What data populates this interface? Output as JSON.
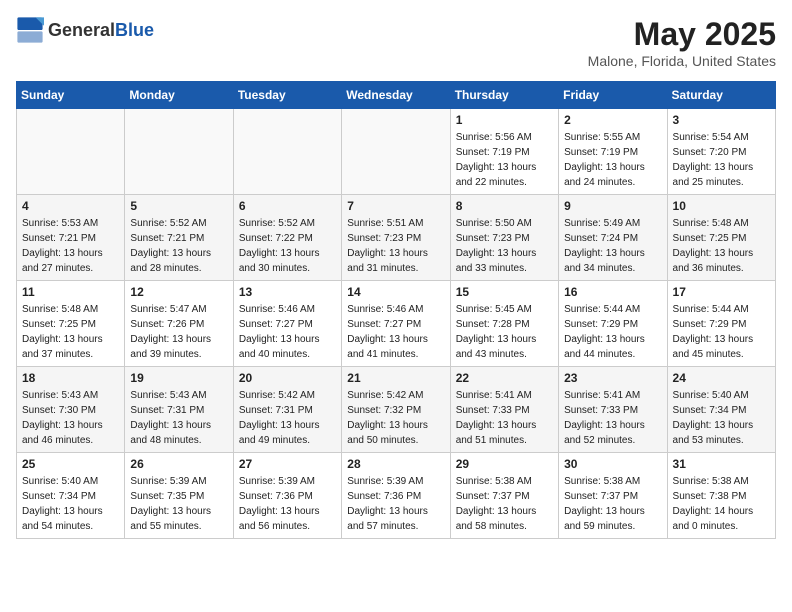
{
  "header": {
    "logo_general": "General",
    "logo_blue": "Blue",
    "title": "May 2025",
    "subtitle": "Malone, Florida, United States"
  },
  "calendar": {
    "days_of_week": [
      "Sunday",
      "Monday",
      "Tuesday",
      "Wednesday",
      "Thursday",
      "Friday",
      "Saturday"
    ],
    "weeks": [
      [
        {
          "day": null,
          "info": null
        },
        {
          "day": null,
          "info": null
        },
        {
          "day": null,
          "info": null
        },
        {
          "day": null,
          "info": null
        },
        {
          "day": "1",
          "info": "Sunrise: 5:56 AM\nSunset: 7:19 PM\nDaylight: 13 hours\nand 22 minutes."
        },
        {
          "day": "2",
          "info": "Sunrise: 5:55 AM\nSunset: 7:19 PM\nDaylight: 13 hours\nand 24 minutes."
        },
        {
          "day": "3",
          "info": "Sunrise: 5:54 AM\nSunset: 7:20 PM\nDaylight: 13 hours\nand 25 minutes."
        }
      ],
      [
        {
          "day": "4",
          "info": "Sunrise: 5:53 AM\nSunset: 7:21 PM\nDaylight: 13 hours\nand 27 minutes."
        },
        {
          "day": "5",
          "info": "Sunrise: 5:52 AM\nSunset: 7:21 PM\nDaylight: 13 hours\nand 28 minutes."
        },
        {
          "day": "6",
          "info": "Sunrise: 5:52 AM\nSunset: 7:22 PM\nDaylight: 13 hours\nand 30 minutes."
        },
        {
          "day": "7",
          "info": "Sunrise: 5:51 AM\nSunset: 7:23 PM\nDaylight: 13 hours\nand 31 minutes."
        },
        {
          "day": "8",
          "info": "Sunrise: 5:50 AM\nSunset: 7:23 PM\nDaylight: 13 hours\nand 33 minutes."
        },
        {
          "day": "9",
          "info": "Sunrise: 5:49 AM\nSunset: 7:24 PM\nDaylight: 13 hours\nand 34 minutes."
        },
        {
          "day": "10",
          "info": "Sunrise: 5:48 AM\nSunset: 7:25 PM\nDaylight: 13 hours\nand 36 minutes."
        }
      ],
      [
        {
          "day": "11",
          "info": "Sunrise: 5:48 AM\nSunset: 7:25 PM\nDaylight: 13 hours\nand 37 minutes."
        },
        {
          "day": "12",
          "info": "Sunrise: 5:47 AM\nSunset: 7:26 PM\nDaylight: 13 hours\nand 39 minutes."
        },
        {
          "day": "13",
          "info": "Sunrise: 5:46 AM\nSunset: 7:27 PM\nDaylight: 13 hours\nand 40 minutes."
        },
        {
          "day": "14",
          "info": "Sunrise: 5:46 AM\nSunset: 7:27 PM\nDaylight: 13 hours\nand 41 minutes."
        },
        {
          "day": "15",
          "info": "Sunrise: 5:45 AM\nSunset: 7:28 PM\nDaylight: 13 hours\nand 43 minutes."
        },
        {
          "day": "16",
          "info": "Sunrise: 5:44 AM\nSunset: 7:29 PM\nDaylight: 13 hours\nand 44 minutes."
        },
        {
          "day": "17",
          "info": "Sunrise: 5:44 AM\nSunset: 7:29 PM\nDaylight: 13 hours\nand 45 minutes."
        }
      ],
      [
        {
          "day": "18",
          "info": "Sunrise: 5:43 AM\nSunset: 7:30 PM\nDaylight: 13 hours\nand 46 minutes."
        },
        {
          "day": "19",
          "info": "Sunrise: 5:43 AM\nSunset: 7:31 PM\nDaylight: 13 hours\nand 48 minutes."
        },
        {
          "day": "20",
          "info": "Sunrise: 5:42 AM\nSunset: 7:31 PM\nDaylight: 13 hours\nand 49 minutes."
        },
        {
          "day": "21",
          "info": "Sunrise: 5:42 AM\nSunset: 7:32 PM\nDaylight: 13 hours\nand 50 minutes."
        },
        {
          "day": "22",
          "info": "Sunrise: 5:41 AM\nSunset: 7:33 PM\nDaylight: 13 hours\nand 51 minutes."
        },
        {
          "day": "23",
          "info": "Sunrise: 5:41 AM\nSunset: 7:33 PM\nDaylight: 13 hours\nand 52 minutes."
        },
        {
          "day": "24",
          "info": "Sunrise: 5:40 AM\nSunset: 7:34 PM\nDaylight: 13 hours\nand 53 minutes."
        }
      ],
      [
        {
          "day": "25",
          "info": "Sunrise: 5:40 AM\nSunset: 7:34 PM\nDaylight: 13 hours\nand 54 minutes."
        },
        {
          "day": "26",
          "info": "Sunrise: 5:39 AM\nSunset: 7:35 PM\nDaylight: 13 hours\nand 55 minutes."
        },
        {
          "day": "27",
          "info": "Sunrise: 5:39 AM\nSunset: 7:36 PM\nDaylight: 13 hours\nand 56 minutes."
        },
        {
          "day": "28",
          "info": "Sunrise: 5:39 AM\nSunset: 7:36 PM\nDaylight: 13 hours\nand 57 minutes."
        },
        {
          "day": "29",
          "info": "Sunrise: 5:38 AM\nSunset: 7:37 PM\nDaylight: 13 hours\nand 58 minutes."
        },
        {
          "day": "30",
          "info": "Sunrise: 5:38 AM\nSunset: 7:37 PM\nDaylight: 13 hours\nand 59 minutes."
        },
        {
          "day": "31",
          "info": "Sunrise: 5:38 AM\nSunset: 7:38 PM\nDaylight: 14 hours\nand 0 minutes."
        }
      ]
    ]
  }
}
